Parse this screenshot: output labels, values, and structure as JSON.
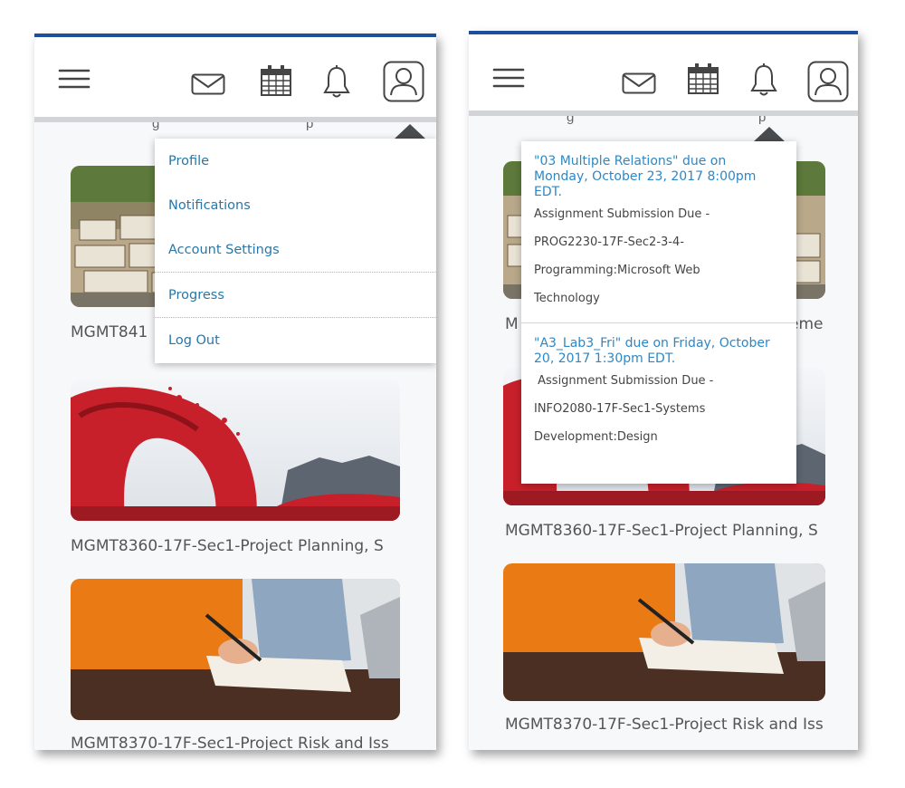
{
  "left_screen": {
    "cut_text": "g",
    "cut_text_right": "p",
    "menu": {
      "items": [
        "Profile",
        "Notifications",
        "Account Settings",
        "Progress",
        "Log Out"
      ]
    },
    "courses": [
      {
        "title": "MGMT841"
      },
      {
        "title": "MGMT8360-17F-Sec1-Project Planning, S"
      },
      {
        "title": "MGMT8370-17F-Sec1-Project Risk and Iss"
      }
    ]
  },
  "right_screen": {
    "cut_text": "g",
    "cut_text_right": "p",
    "notifications": [
      {
        "title": "\"03 Multiple Relations\" due on Monday, October 23, 2017 8:00pm EDT.",
        "lines": [
          "Assignment Submission Due -",
          "PROG2230-17F-Sec2-3-4-",
          "Programming:Microsoft Web",
          "Technology"
        ]
      },
      {
        "title": "\"A3_Lab3_Fri\" due on Friday, October 20, 2017 1:30pm EDT.",
        "lines": [
          " Assignment Submission Due -",
          "INFO2080-17F-Sec1-Systems",
          "Development:Design"
        ]
      }
    ],
    "courses": [
      {
        "title": "M",
        "title_right": "eme"
      },
      {
        "title": "MGMT8360-17F-Sec1-Project Planning, S"
      },
      {
        "title": "MGMT8370-17F-Sec1-Project Risk and Iss"
      }
    ]
  },
  "icons": {
    "menu": "hamburger-icon",
    "mail": "mail-icon",
    "calendar": "calendar-icon",
    "bell": "bell-icon",
    "profile": "profile-icon"
  },
  "colors": {
    "topbar": "#1f4f9a",
    "link": "#2877a8",
    "notif_title": "#2e87c4"
  }
}
